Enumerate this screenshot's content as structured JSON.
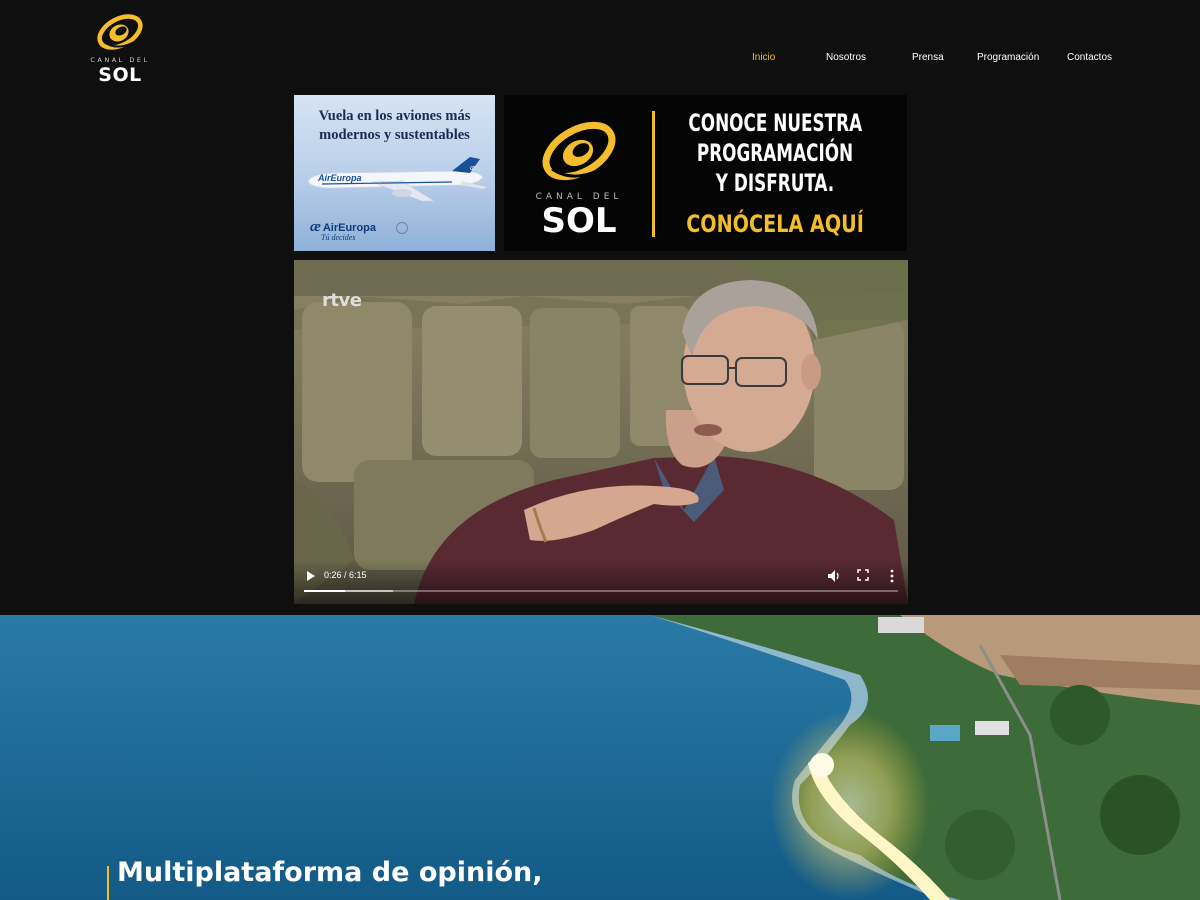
{
  "header": {
    "logo": {
      "top_text": "CANAL DEL",
      "main_text": "SOL"
    },
    "nav": [
      {
        "label": "Inicio",
        "active": true
      },
      {
        "label": "Nosotros",
        "active": false
      },
      {
        "label": "Prensa",
        "active": false
      },
      {
        "label": "Programación",
        "active": false
      },
      {
        "label": "Contactos",
        "active": false
      }
    ]
  },
  "ad_banner": {
    "headline": "Vuela en los aviones más modernos y sustentables",
    "plane_livery": "AirEuropa",
    "brand": "AirEuropa",
    "brand_mark": "æ",
    "tagline": "Tú decides"
  },
  "promo_banner": {
    "logo_top_text": "CANAL DEL",
    "logo_main_text": "SOL",
    "line1": "CONOCE NUESTRA",
    "line2": "PROGRAMACIÓN",
    "line3": "Y DISFRUTA.",
    "cta": "CONÓCELA AQUÍ"
  },
  "video": {
    "watermark": "rtve",
    "current_time": "0:26",
    "duration": "6:15",
    "time_label": "0:26 / 6:15",
    "progress_fraction": 0.0693,
    "buffered_fraction": 0.15,
    "icons": [
      "play-icon",
      "volume-icon",
      "fullscreen-icon",
      "more-options-icon"
    ]
  },
  "hero": {
    "title": "Multiplataforma de opinión,"
  },
  "colors": {
    "accent": "#f3bd2c",
    "background": "#0f0f0f",
    "sea": "#1f6f9c"
  }
}
